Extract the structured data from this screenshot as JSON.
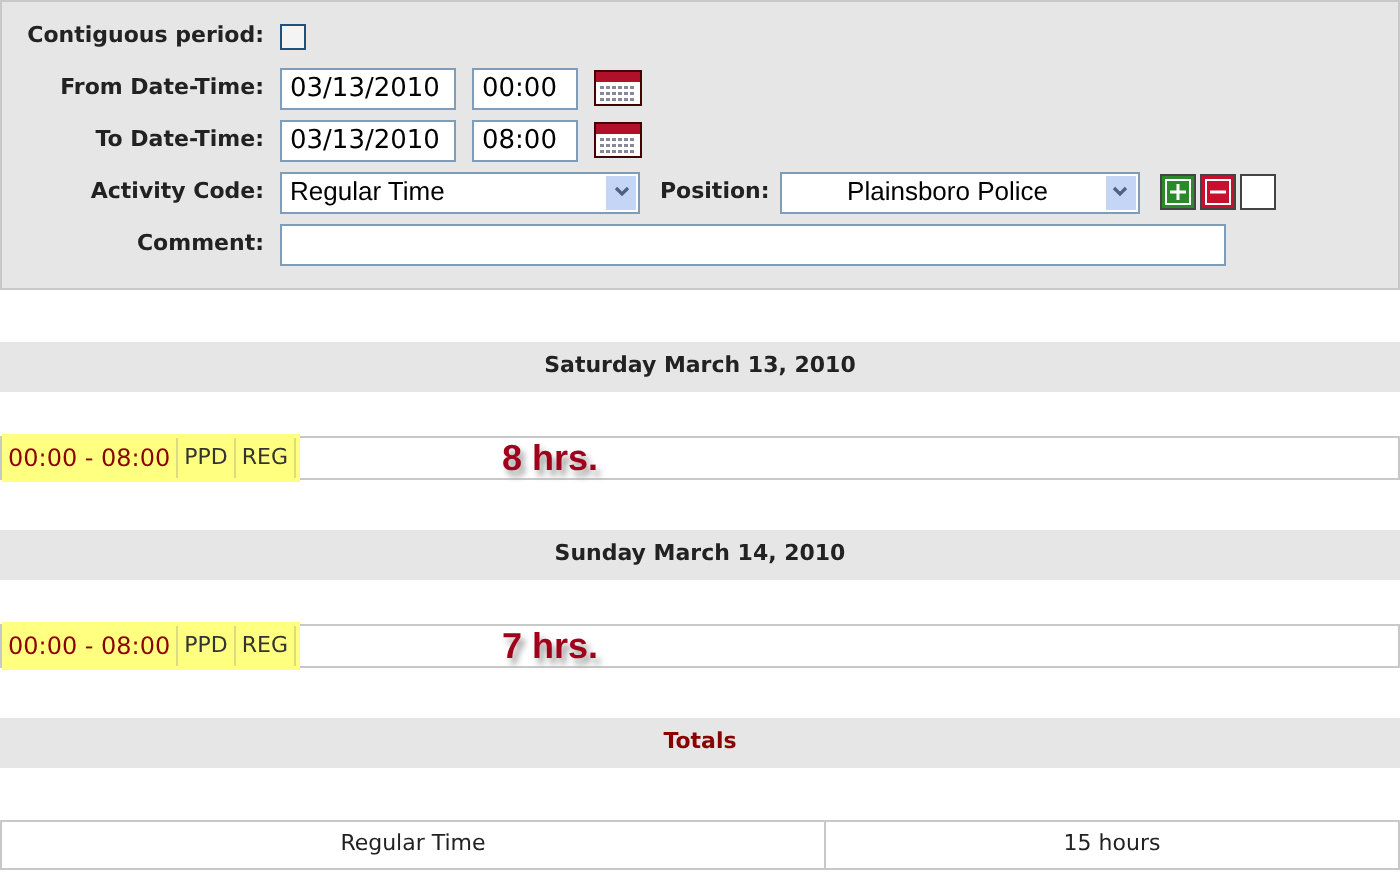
{
  "form": {
    "contiguous": {
      "label": "Contiguous period:",
      "checked": false
    },
    "from": {
      "label": "From Date-Time:",
      "date": "03/13/2010",
      "time": "00:00"
    },
    "to": {
      "label": "To Date-Time:",
      "date": "03/13/2010",
      "time": "08:00"
    },
    "activity": {
      "label": "Activity Code:",
      "value": "Regular Time"
    },
    "position": {
      "label": "Position:",
      "value": "Plainsboro Police"
    },
    "comment": {
      "label": "Comment:"
    }
  },
  "days": [
    {
      "heading": "Saturday March 13, 2010",
      "entries": [
        {
          "time": "00:00 - 08:00",
          "code_1": "PPD",
          "code_2": "REG"
        }
      ],
      "hours": "8 hrs."
    },
    {
      "heading": "Sunday March 14, 2010",
      "entries": [
        {
          "time": "00:00 - 08:00",
          "code_1": "PPD",
          "code_2": "REG"
        }
      ],
      "hours": "7 hrs."
    }
  ],
  "totals": {
    "heading": "Totals",
    "rows": [
      {
        "activity": "Regular Time",
        "amount": "15 hours"
      }
    ]
  }
}
